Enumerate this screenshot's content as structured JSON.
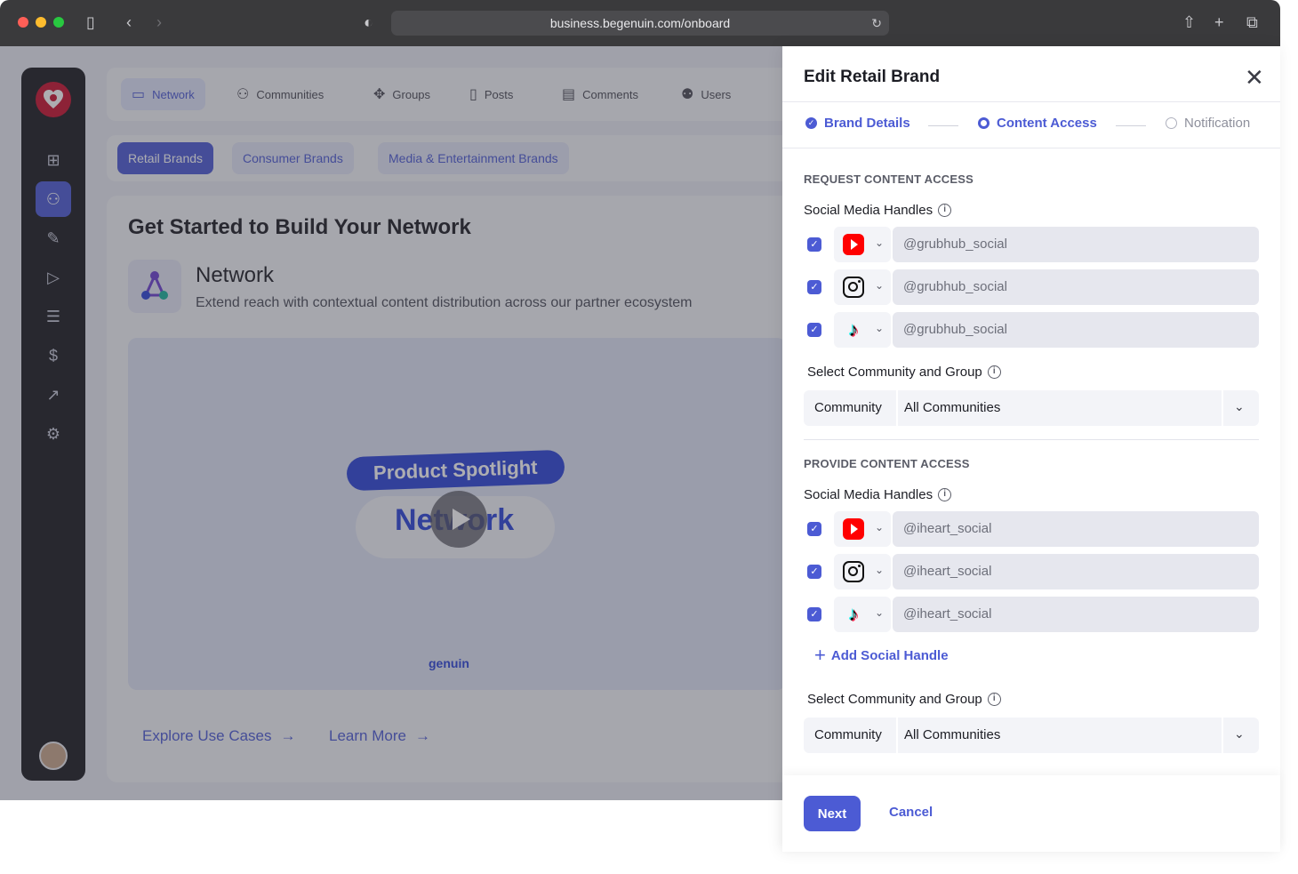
{
  "browser": {
    "url": "business.begenuin.com/onboard"
  },
  "app": {
    "nav_tabs": [
      {
        "label": "Network",
        "icon": "briefcase-icon"
      },
      {
        "label": "Communities",
        "icon": "people-icon"
      },
      {
        "label": "Groups",
        "icon": "groups-icon"
      },
      {
        "label": "Posts",
        "icon": "posts-icon"
      },
      {
        "label": "Comments",
        "icon": "comments-icon"
      },
      {
        "label": "Users",
        "icon": "users-icon"
      }
    ],
    "brand_chips": [
      "Retail Brands",
      "Consumer Brands",
      "Media & Entertainment Brands"
    ],
    "card_title": "Get Started to Build Your Network",
    "network_title": "Network",
    "network_desc": "Extend reach with contextual content distribution across our partner ecosystem",
    "video": {
      "pill": "Product Spotlight",
      "word": "Network",
      "brand": "genuin"
    },
    "links": [
      "Explore Use Cases",
      "Learn More"
    ]
  },
  "panel": {
    "title": "Edit Retail Brand",
    "steps": [
      {
        "label": "Brand Details",
        "state": "done"
      },
      {
        "label": "Content Access",
        "state": "current"
      },
      {
        "label": "Notification",
        "state": "upcoming"
      }
    ],
    "request": {
      "section": "REQUEST CONTENT ACCESS",
      "handles_label": "Social Media Handles",
      "handles": [
        {
          "platform": "youtube-icon",
          "value": "@grubhub_social",
          "checked": true
        },
        {
          "platform": "instagram-icon",
          "value": "@grubhub_social",
          "checked": true
        },
        {
          "platform": "tiktok-icon",
          "value": "@grubhub_social",
          "checked": true
        }
      ],
      "community_label": "Select Community and Group",
      "community_field": "Community",
      "community_value": "All Communities"
    },
    "provide": {
      "section": "PROVIDE CONTENT ACCESS",
      "handles_label": "Social Media Handles",
      "handles": [
        {
          "platform": "youtube-icon",
          "value": "@iheart_social",
          "checked": true
        },
        {
          "platform": "instagram-icon",
          "value": "@iheart_social",
          "checked": true
        },
        {
          "platform": "tiktok-icon",
          "value": "@iheart_social",
          "checked": true
        }
      ],
      "add_handle": "Add Social Handle",
      "community_label": "Select Community and Group",
      "community_field": "Community",
      "community_value": "All Communities"
    },
    "next_label": "Next",
    "cancel_label": "Cancel"
  },
  "colors": {
    "accent": "#4c5bd4",
    "sidebar": "#1a1b1f",
    "brand_red": "#c8102e"
  }
}
